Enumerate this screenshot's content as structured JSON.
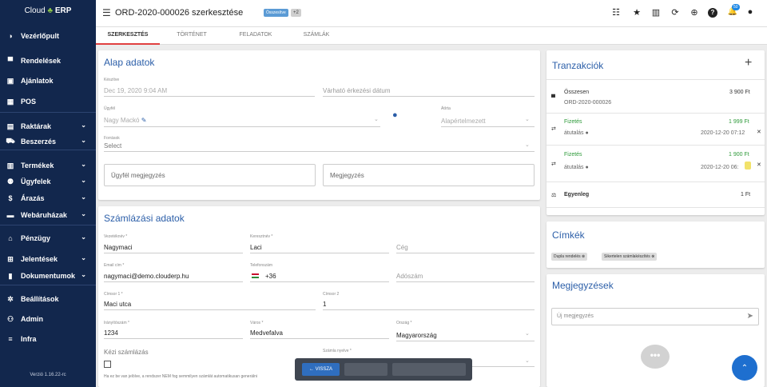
{
  "sidebar": {
    "logo_text": "Cloud",
    "logo_leaf": "♣",
    "logo_bold": "ERP",
    "version": "Verzió 1.16.22-rc",
    "items": [
      {
        "label": "Vezérlőpult",
        "icon": "◑",
        "name": "dashboard"
      },
      {
        "label": "Rendelések",
        "icon": "▀",
        "name": "orders"
      },
      {
        "label": "Ajánlatok",
        "icon": "▣",
        "name": "offers"
      },
      {
        "label": "POS",
        "icon": "▦",
        "name": "pos"
      },
      {
        "label": "Raktárak",
        "icon": "▤",
        "name": "warehouses",
        "chev": "⌄"
      },
      {
        "label": "Beszerzés",
        "icon": "⛟",
        "name": "purchasing",
        "chev": "⌄"
      },
      {
        "label": "Termékek",
        "icon": "▥",
        "name": "products",
        "chev": "⌄"
      },
      {
        "label": "Ügyfelek",
        "icon": "⚉",
        "name": "customers",
        "chev": "⌄"
      },
      {
        "label": "Árazás",
        "icon": "$",
        "name": "pricing",
        "chev": "⌄"
      },
      {
        "label": "Webáruházak",
        "icon": "▬",
        "name": "webshops",
        "chev": "⌄"
      },
      {
        "label": "Pénzügy",
        "icon": "⌂",
        "name": "finance",
        "chev": "⌄"
      },
      {
        "label": "Jelentések",
        "icon": "⊞",
        "name": "reports",
        "chev": "⌄"
      },
      {
        "label": "Dokumentumok",
        "icon": "▮",
        "name": "documents",
        "chev": "⌄"
      },
      {
        "label": "Beállítások",
        "icon": "✲",
        "name": "settings"
      },
      {
        "label": "Admin",
        "icon": "⚇",
        "name": "admin"
      },
      {
        "label": "Infra",
        "icon": "≡",
        "name": "infra"
      }
    ]
  },
  "topbar": {
    "hamburger": "☰",
    "title": "ORD-2020-000026 szerkesztése",
    "status_badge": "Összesítve",
    "count_badge": "+2",
    "icons": {
      "list": "☷",
      "star": "★",
      "building": "▥",
      "sync": "⟳",
      "globe": "⊕",
      "help": "?",
      "bell": "🔔",
      "user": "●"
    },
    "notif_count": "50"
  },
  "tabs": [
    "SZERKESZTÉS",
    "TÖRTÉNET",
    "FELADATOK",
    "SZÁMLÁK"
  ],
  "basic": {
    "title": "Alap adatok",
    "created_label": "Készítve",
    "created_value": "Dec 19, 2020 9:04 AM",
    "expected_placeholder": "Várható érkezési dátum",
    "customer_label": "Ügyfél",
    "customer_value": "Nagy Mackó",
    "agent_label": "Átírta",
    "agent_value": "Alapértelmezett",
    "source_label": "Források",
    "source_value": "Select",
    "customer_note": "Ügyfél megjegyzés",
    "note": "Megjegyzés"
  },
  "billing": {
    "title": "Számlázási adatok",
    "lastname_label": "Vezetéknév *",
    "lastname": "Nagymaci",
    "firstname_label": "Keresztnév *",
    "firstname": "Laci",
    "company": "Cég",
    "email_label": "Email cím *",
    "email": "nagymaci@demo.clouderp.hu",
    "phone_label": "Telefonszám",
    "phone": "+36",
    "taxid": "Adószám",
    "addr1_label": "Címsor 1 *",
    "addr1": "Maci utca",
    "addr2_label": "Címsor 2",
    "addr2": "1",
    "zip_label": "Irányítószám *",
    "zip": "1234",
    "city_label": "Város *",
    "city": "Medvefalva",
    "country_label": "Ország *",
    "country": "Magyarország",
    "manual": "Kézi számlázás",
    "invoice_lang_label": "Számla nyelve *",
    "manual_note": "Ha ez be van jelölve, a rendszer NEM fog semmilyen számlát automatikusan generálni"
  },
  "actions": {
    "back": "← VISSZA"
  },
  "transactions": {
    "title": "Tranzakciók",
    "add": "+",
    "total_label": "Összesen",
    "total_order": "ORD-2020-000026",
    "total_amount": "3 900 Ft",
    "pay1_label": "Fizetés",
    "pay1_amount": "1 999 Ft",
    "pay1_method": "átutalás",
    "pay1_date": "2020-12-20 07:12",
    "pay2_label": "Fizetés",
    "pay2_amount": "1 900 Ft",
    "pay2_method": "átutalás",
    "pay2_date": "2020-12-20 06:",
    "balance_label": "Egyenleg",
    "balance": "1 Ft"
  },
  "tags": {
    "title": "Címkék",
    "items": [
      "Dupla rendelés",
      "Sikertelen számlakészítés"
    ]
  },
  "notes": {
    "title": "Megjegyzések",
    "placeholder": "Új megjegyzés"
  },
  "colors": {
    "sidebar": "#12274d",
    "accent": "#2b5ea8",
    "green": "#2e9a3a",
    "fab": "#1e6fcf"
  }
}
